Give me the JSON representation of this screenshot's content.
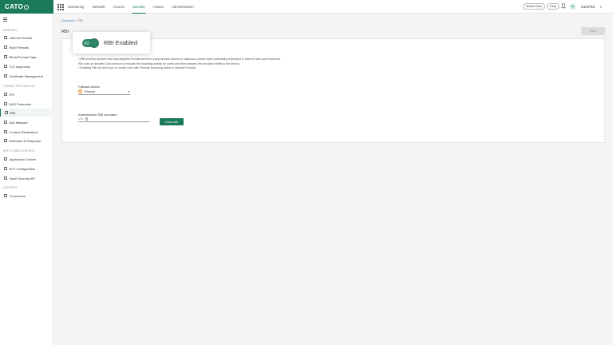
{
  "brand": {
    "logo_text": "CATO",
    "accent": "#1a7a5a"
  },
  "topnav": [
    "Monitoring",
    "Network",
    "Access",
    "Security",
    "Assets",
    "Administration"
  ],
  "topnav_active": "Security",
  "header": {
    "whats_new": "What's New",
    "help": "Help",
    "user_initials": "CC",
    "user_name": "CatoPilot"
  },
  "sidebar": {
    "sections": [
      {
        "title": "FIREWALL",
        "items": [
          "Internet Firewall",
          "WAN Firewall",
          "Block/Prompt Page",
          "TLS Inspection",
          "Certificate Management"
        ]
      },
      {
        "title": "THREAT PREVENTION",
        "items": [
          "IPS",
          "DNS Protection",
          "RBI",
          "Anti-Malware",
          "Content Restrictions",
          "Detection & Response"
        ]
      },
      {
        "title": "APP & DATA CONTROL",
        "items": [
          "Application Control",
          "DLP Configuration",
          "SaaS Security API"
        ]
      },
      {
        "title": "CONTENT",
        "items": [
          "Connectors"
        ]
      }
    ],
    "active_item": "RBI"
  },
  "breadcrumb": {
    "root": "Accounts",
    "sep": "/",
    "current": "RBI"
  },
  "page": {
    "title": "RBI",
    "save_label": "Save"
  },
  "description": [
    "• RBI protects devices from web-targeted threats and from compromises based on malicious content that's potentially embedded in internet sites and resources.",
    "  RBI uses an isolated Cato service to emulate the browsing activity for users and then streams the emulated traffic to the device.",
    "• Enabling RBI will allow you to create rules with Remote Browsing action in Internet Firewall."
  ],
  "fallback": {
    "label": "Fallback Action",
    "value": "Prompt"
  },
  "simulator": {
    "label": "Administrator RBI simulator",
    "input_label": "URL",
    "button": "Generate"
  },
  "popup": {
    "label": "RBI Enabled",
    "enabled": true
  }
}
